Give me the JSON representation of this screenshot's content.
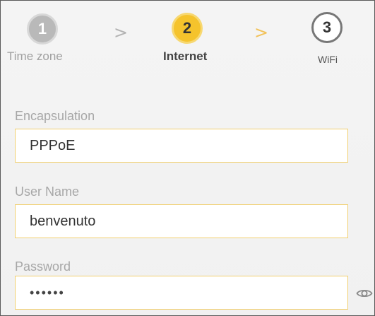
{
  "wizard": {
    "steps": [
      {
        "number": "1",
        "label": "Time zone",
        "state": "completed"
      },
      {
        "number": "2",
        "label": "Internet",
        "state": "active"
      },
      {
        "number": "3",
        "label": "WiFi",
        "state": "upcoming"
      }
    ],
    "separators": [
      ">",
      ">"
    ]
  },
  "form": {
    "encapsulation": {
      "label": "Encapsulation",
      "value": "PPPoE"
    },
    "username": {
      "label": "User Name",
      "value": "benvenuto"
    },
    "password": {
      "label": "Password",
      "value": "••••••"
    }
  },
  "icons": {
    "password_toggle": "eye-icon"
  },
  "colors": {
    "accent": "#f5c32c",
    "input_border": "#f1cf6f",
    "inactive_step": "#b9b9b9",
    "label": "#a7a7a7"
  }
}
